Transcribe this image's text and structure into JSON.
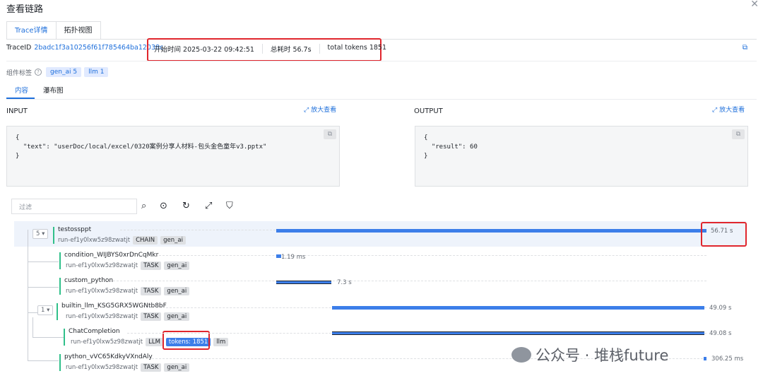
{
  "window": {
    "title": "查看链路"
  },
  "tabs": [
    {
      "label": "Trace详情",
      "active": true
    },
    {
      "label": "拓扑视图",
      "active": false
    }
  ],
  "trace": {
    "id_label": "TraceID",
    "id_value": "2badc1f3a10256f61f785464ba12038c",
    "start_time": "开始时间 2025-03-22 09:42:51",
    "total_duration": "总耗时 56.7s",
    "total_tokens": "total tokens 1851"
  },
  "components": {
    "label": "组件标签",
    "chips": [
      "gen_ai 5",
      "llm 1"
    ]
  },
  "content_tabs": [
    {
      "label": "内容",
      "active": true
    },
    {
      "label": "瀑布图",
      "active": false
    }
  ],
  "input": {
    "label": "INPUT",
    "zoom": "放大查看",
    "code": "{\n  \"text\": \"userDoc/local/excel/0320案例分享人材料-包头金色童年v3.pptx\"\n}"
  },
  "output": {
    "label": "OUTPUT",
    "zoom": "放大查看",
    "code": "{\n  \"result\": 60\n}"
  },
  "filter": {
    "placeholder": "过滤"
  },
  "tree": {
    "root_toggle": "5",
    "llm_toggle": "1",
    "nodes": [
      {
        "name": "testossppt",
        "run": "run-ef1y0lxw5z98zwatjt",
        "tags": [
          "CHAIN",
          "gen_ai"
        ],
        "duration": "56.71 s"
      },
      {
        "name": "condition_WIJBYS0xrDnCqMkr",
        "run": "run-ef1y0lxw5z98zwatjt",
        "tags": [
          "TASK",
          "gen_ai"
        ],
        "duration": "1.19 ms"
      },
      {
        "name": "custom_python",
        "run": "run-ef1y0lxw5z98zwatjt",
        "tags": [
          "TASK",
          "gen_ai"
        ],
        "duration": "7.3 s"
      },
      {
        "name": "builtin_llm_KSG5GRX5WGNtb8bF",
        "run": "run-ef1y0lxw5z98zwatjt",
        "tags": [
          "TASK",
          "gen_ai"
        ],
        "duration": "49.09 s"
      },
      {
        "name": "ChatCompletion",
        "run": "run-ef1y0lxw5z98zwatjt",
        "tags": [
          "LLM",
          "tokens: 1851",
          "llm"
        ],
        "duration": "49.08 s"
      },
      {
        "name": "python_vVC65KdkyVXndAly",
        "run": "run-ef1y0lxw5z98zwatjt",
        "tags": [
          "TASK",
          "gen_ai"
        ],
        "duration": "306.25 ms"
      }
    ]
  },
  "watermark": "公众号 · 堆栈future",
  "colors": {
    "accent": "#1e6fdb",
    "bar": "#3c7ee9",
    "highlight": "#e0262d",
    "node": "#30c08a"
  }
}
